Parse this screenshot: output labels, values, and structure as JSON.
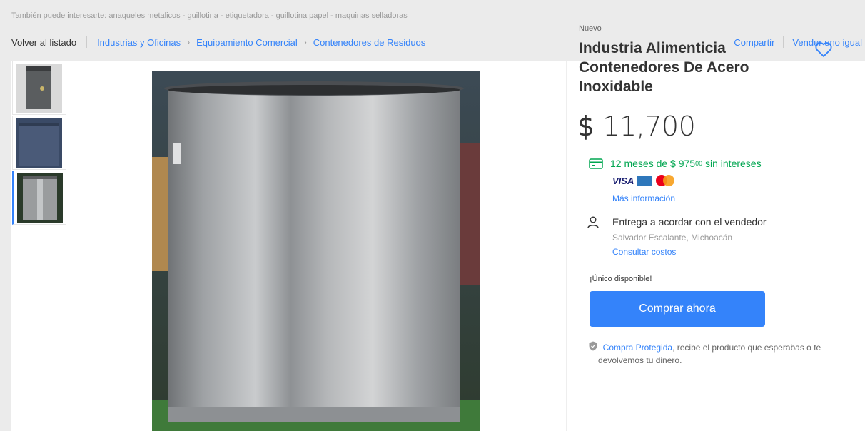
{
  "suggestions": {
    "prefix": "También puede interesarte:",
    "items": [
      "anaqueles metalicos",
      "guillotina",
      "etiquetadora",
      "guillotina papel",
      "maquinas selladoras"
    ]
  },
  "breadcrumb": {
    "back": "Volver al listado",
    "path": [
      "Industrias y Oficinas",
      "Equipamiento Comercial",
      "Contenedores de Residuos"
    ]
  },
  "actions": {
    "share": "Compartir",
    "sell_same": "Vender uno igual"
  },
  "product": {
    "condition": "Nuevo",
    "title": "Industria Alimenticia Contenedores De Acero Inoxidable",
    "price_currency": "$",
    "price": "11,700",
    "installments_text": "12 meses de $ 975",
    "installments_cents": "00",
    "installments_suffix": "sin intereses",
    "more_info": "Más información",
    "delivery": "Entrega a acordar con el vendedor",
    "location": "Salvador Escalante, Michoacán",
    "costs_link": "Consultar costos",
    "stock": "¡Único disponible!",
    "buy_label": "Comprar ahora",
    "protect_link": "Compra Protegida",
    "protect_text": ", recibe el producto que esperabas o te devolvemos tu dinero."
  },
  "payment_brands": {
    "visa": "VISA"
  },
  "colors": {
    "accent": "#3483fa",
    "green": "#00a650",
    "background": "#ebebeb"
  },
  "icons": [
    "heart-icon",
    "card-icon",
    "person-icon",
    "shield-icon",
    "chevron-right-icon"
  ]
}
